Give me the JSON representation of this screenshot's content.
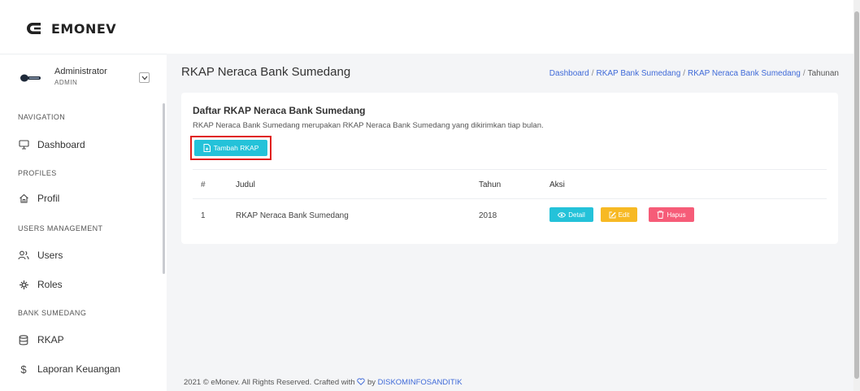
{
  "app": {
    "name": "EMONEV"
  },
  "user": {
    "name": "Administrator",
    "role": "ADMIN"
  },
  "sidebar": {
    "sections": [
      {
        "label": "NAVIGATION",
        "items": [
          {
            "label": "Dashboard",
            "icon": "monitor-icon"
          }
        ]
      },
      {
        "label": "PROFILES",
        "items": [
          {
            "label": "Profil",
            "icon": "home-icon"
          }
        ]
      },
      {
        "label": "USERS MANAGEMENT",
        "items": [
          {
            "label": "Users",
            "icon": "users-icon"
          },
          {
            "label": "Roles",
            "icon": "roles-icon"
          }
        ]
      },
      {
        "label": "BANK SUMEDANG",
        "items": [
          {
            "label": "RKAP",
            "icon": "database-icon"
          },
          {
            "label": "Laporan Keuangan",
            "icon": "dollar-icon"
          }
        ]
      }
    ]
  },
  "page": {
    "title": "RKAP Neraca Bank Sumedang",
    "breadcrumb": [
      "Dashboard",
      "RKAP Bank Sumedang",
      "RKAP Neraca Bank Sumedang",
      "Tahunan"
    ],
    "breadcrumb_sep": "/"
  },
  "card": {
    "title": "Daftar RKAP Neraca Bank Sumedang",
    "description": "RKAP Neraca Bank Sumedang merupakan RKAP Neraca Bank Sumedang yang dikirimkan tiap bulan.",
    "add_button": "Tambah RKAP"
  },
  "table": {
    "headers": {
      "num": "#",
      "judul": "Judul",
      "tahun": "Tahun",
      "aksi": "Aksi"
    },
    "rows": [
      {
        "num": "1",
        "judul": "RKAP Neraca Bank Sumedang",
        "tahun": "2018"
      }
    ],
    "actions": {
      "detail": "Detail",
      "edit": "Edit",
      "hapus": "Hapus"
    }
  },
  "footer": {
    "text": "2021 © eMonev. All Rights Reserved. Crafted with",
    "by": "by",
    "link": "DISKOMINFOSANDITIK"
  },
  "colors": {
    "info": "#24c2d9",
    "warning": "#f7b924",
    "danger": "#f65c78",
    "link": "#3f6ad8",
    "highlight": "#e0201b"
  }
}
